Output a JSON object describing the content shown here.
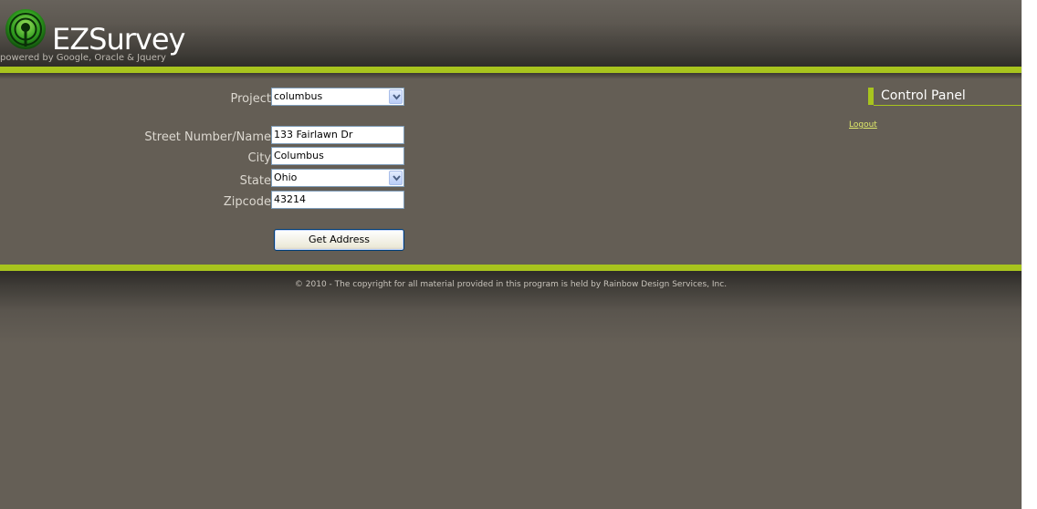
{
  "header": {
    "brand": "EZSurvey",
    "tagline": "powered by Google, Oracle & Jquery",
    "logo_icon": "radio-signal-icon",
    "accent_color": "#a8c41e"
  },
  "form": {
    "project_label": "Project",
    "project_value": "columbus",
    "street_label": "Street Number/Name",
    "street_value": "133 Fairlawn Dr",
    "city_label": "City",
    "city_value": "Columbus",
    "state_label": "State",
    "state_value": "Ohio",
    "zip_label": "Zipcode",
    "zip_value": "43214",
    "submit_label": "Get Address"
  },
  "control_panel": {
    "title": "Control Panel",
    "logout_label": "Logout"
  },
  "footer": {
    "copyright": "© 2010 - The copyright for all material provided in this program is held by Rainbow Design Services, Inc."
  }
}
